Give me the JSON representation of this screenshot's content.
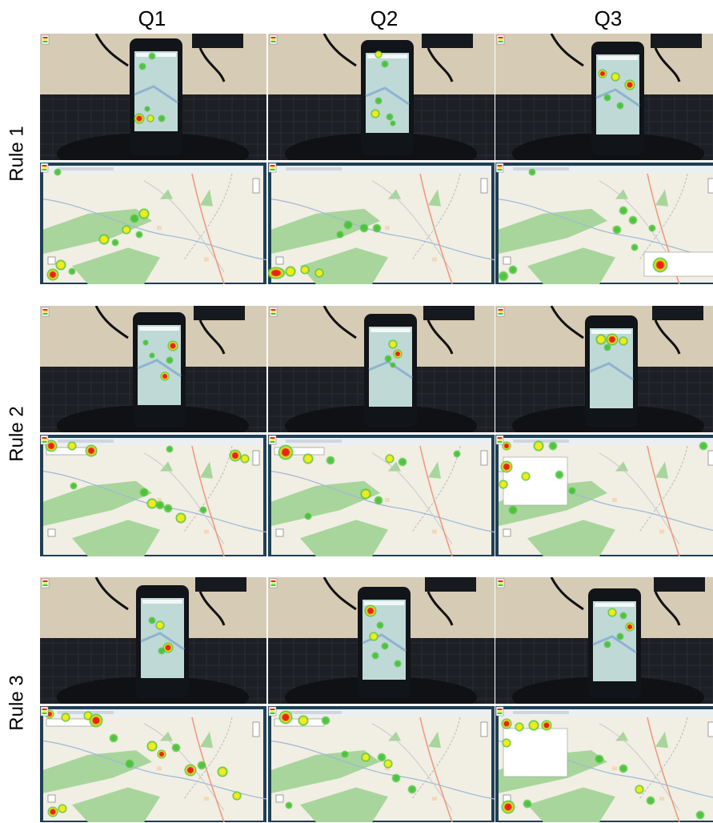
{
  "columns": [
    "Q1",
    "Q2",
    "Q3"
  ],
  "rows": [
    "Rule 1",
    "Rule 2",
    "Rule 3"
  ],
  "colors": {
    "desk": "#d6cbb4",
    "mat": "#1c1f24",
    "phone": "#111418",
    "phone_screen": "#bfd9d6",
    "map_bg": "#f1eee4",
    "forest": "#a8d59b",
    "road": "#ec9b7d",
    "river": "#9db9d6",
    "frame": "#1f3f55",
    "heat_green": "#45c234",
    "heat_yellow": "#f2ea1e",
    "heat_red": "#e8241a"
  }
}
